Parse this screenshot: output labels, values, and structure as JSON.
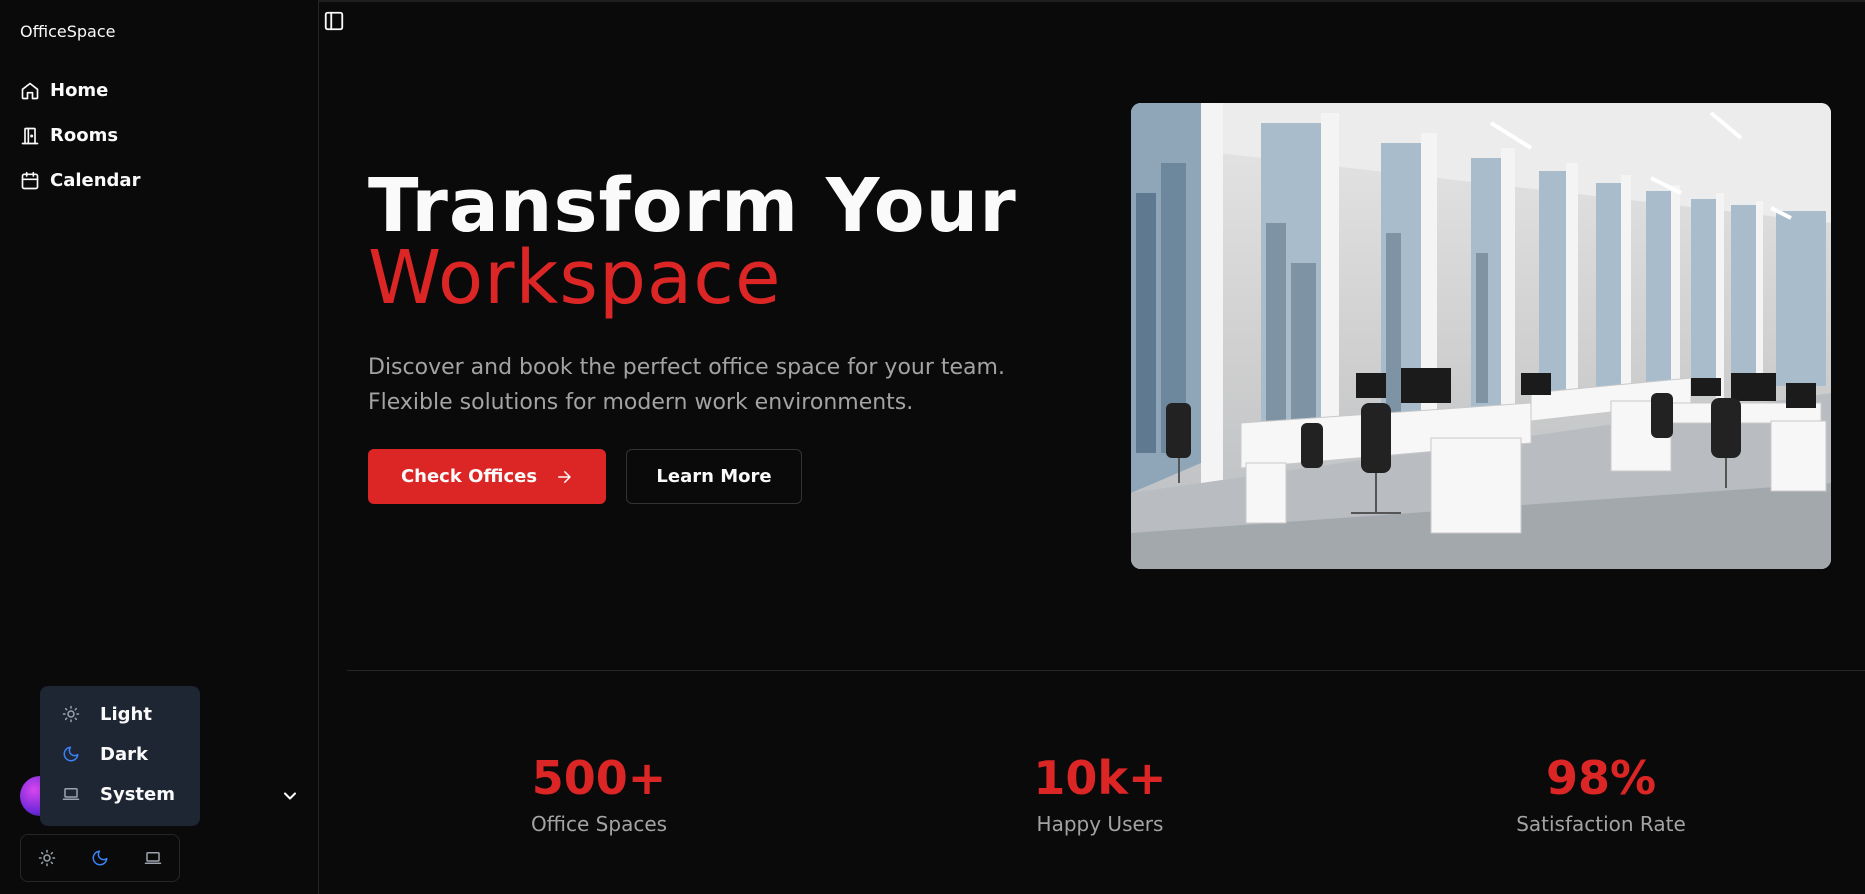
{
  "app": {
    "brand": "OfficeSpace"
  },
  "sidebar": {
    "items": [
      {
        "label": "Home",
        "icon": "home-icon"
      },
      {
        "label": "Rooms",
        "icon": "door-icon"
      },
      {
        "label": "Calendar",
        "icon": "calendar-icon"
      }
    ]
  },
  "theme_menu": {
    "options": [
      {
        "label": "Light",
        "icon": "sun-icon"
      },
      {
        "label": "Dark",
        "icon": "moon-icon",
        "selected": true
      },
      {
        "label": "System",
        "icon": "laptop-icon"
      }
    ]
  },
  "hero": {
    "title_line1": "Transform Your",
    "title_line2": "Workspace",
    "description_line1": "Discover and book the perfect office space for your team.",
    "description_line2": "Flexible solutions for modern work environments.",
    "primary_button": "Check Offices",
    "secondary_button": "Learn More"
  },
  "stats": [
    {
      "value": "500+",
      "label": "Office Spaces"
    },
    {
      "value": "10k+",
      "label": "Happy Users"
    },
    {
      "value": "98%",
      "label": "Satisfaction Rate"
    }
  ],
  "colors": {
    "accent": "#dc2626",
    "background": "#0a0a0a",
    "menu_bg": "#1e2533",
    "selected_icon": "#3b82f6"
  }
}
